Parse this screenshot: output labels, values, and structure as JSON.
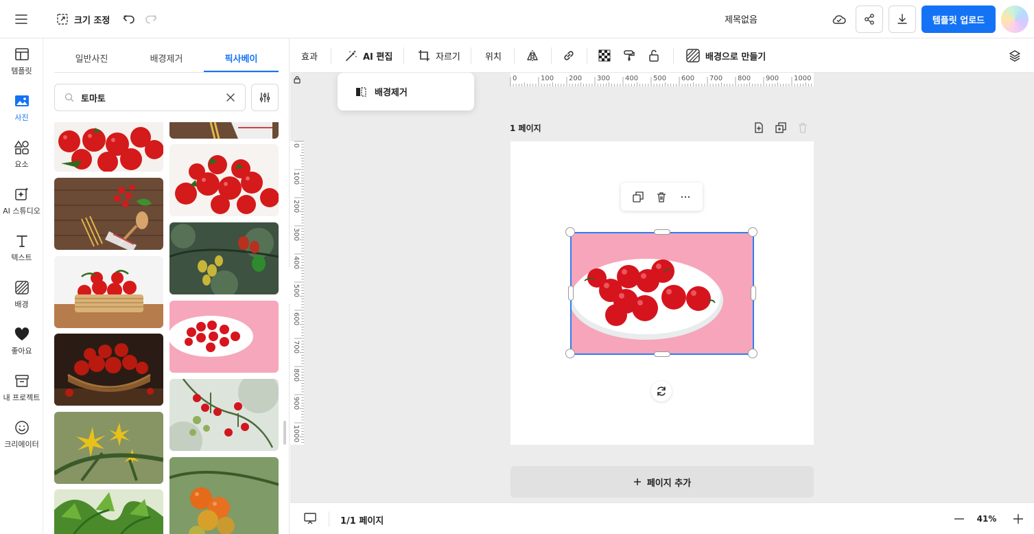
{
  "header": {
    "resize_label": "크기 조정",
    "doc_title": "제목없음",
    "upload_label": "템플릿 업로드"
  },
  "nav": [
    {
      "label": "템플릿",
      "icon": "template-icon"
    },
    {
      "label": "사진",
      "icon": "photo-icon",
      "active": true
    },
    {
      "label": "요소",
      "icon": "elements-icon"
    },
    {
      "label": "AI 스튜디오",
      "icon": "ai-studio-icon"
    },
    {
      "label": "텍스트",
      "icon": "text-icon"
    },
    {
      "label": "배경",
      "icon": "background-icon"
    },
    {
      "label": "좋아요",
      "icon": "heart-icon"
    },
    {
      "label": "내 프로젝트",
      "icon": "project-icon"
    },
    {
      "label": "크리에이터",
      "icon": "creator-icon"
    }
  ],
  "panel": {
    "tabs": [
      "일반사진",
      "배경제거",
      "픽사베이"
    ],
    "active_tab": 2,
    "search_value": "토마토"
  },
  "toolbar": {
    "effect": "효과",
    "ai_edit": "AI 편집",
    "crop": "자르기",
    "position": "위치",
    "make_background": "배경으로 만들기"
  },
  "dropdown": {
    "remove_bg": "배경제거"
  },
  "canvas": {
    "page_label": "1 페이지",
    "add_page": "페이지 추가",
    "ruler_top": [
      "0",
      "100",
      "200",
      "300",
      "400",
      "500",
      "600",
      "700",
      "800",
      "900",
      "1000"
    ],
    "ruler_left": [
      "0",
      "100",
      "200",
      "300",
      "400",
      "500",
      "600",
      "700",
      "800",
      "900",
      "1000"
    ]
  },
  "bottom": {
    "page_count": "1/1 페이지",
    "zoom": "41%"
  },
  "colors": {
    "accent": "#1473f5",
    "selection": "#2a7df6"
  }
}
